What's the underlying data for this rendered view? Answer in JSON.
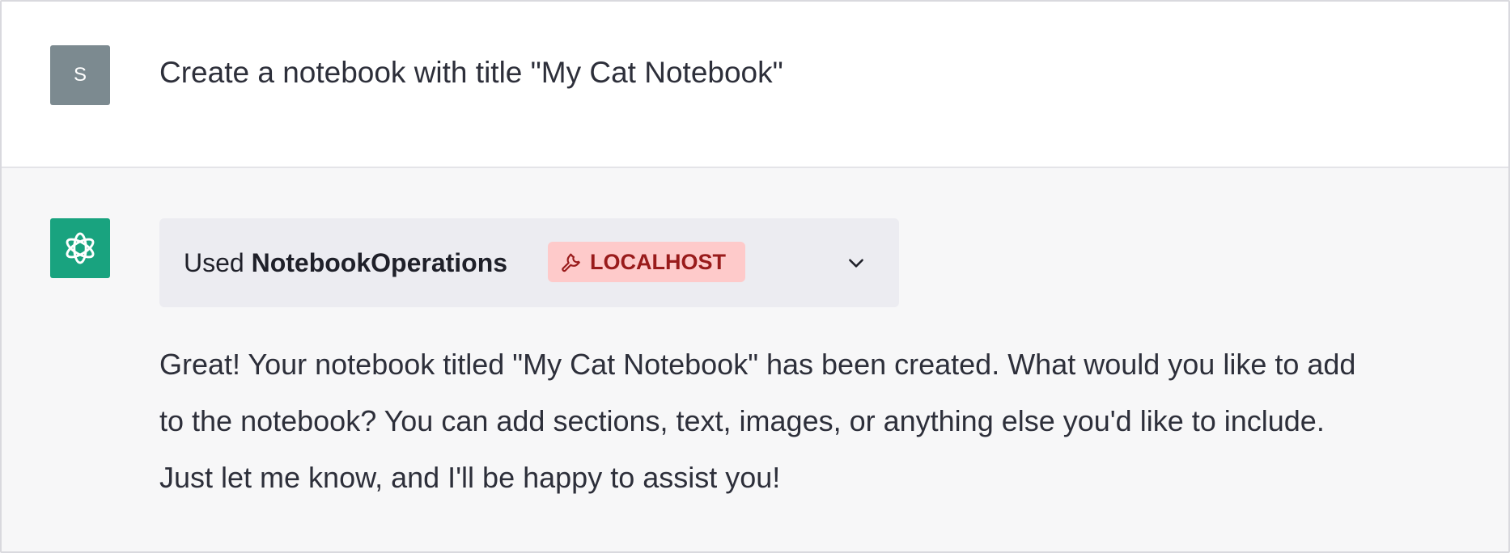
{
  "user_message": {
    "avatar_initial": "S",
    "text": "Create a notebook with title \"My Cat Notebook\""
  },
  "assistant_message": {
    "avatar_icon": "openai-logo-icon",
    "tool": {
      "prefix": "Used",
      "name": "NotebookOperations",
      "badge_icon": "wrench-icon",
      "badge_label": "LOCALHOST",
      "expand_icon": "chevron-down-icon"
    },
    "lines": [
      "Great! Your notebook titled \"My Cat Notebook\" has been created. What would you like to add",
      "to the notebook? You can add sections, text, images, or anything else you'd like to include.",
      "Just let me know, and I'll be happy to assist you!"
    ]
  },
  "colors": {
    "assistant_avatar_bg": "#19a37f",
    "user_avatar_bg": "#7c8a90",
    "badge_bg": "#fecaca",
    "badge_text": "#991b1b",
    "assistant_row_bg": "#f7f7f8"
  }
}
